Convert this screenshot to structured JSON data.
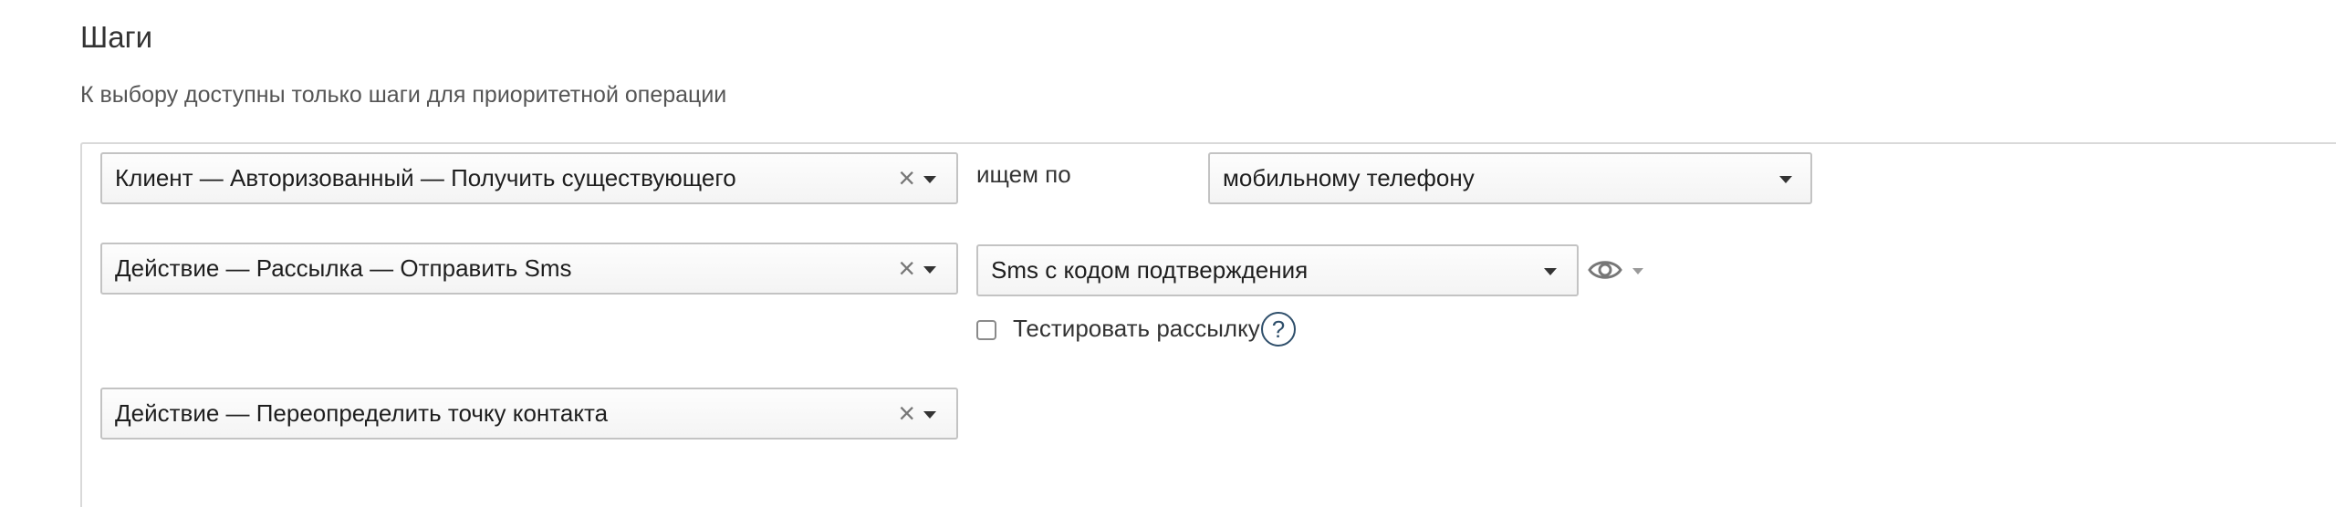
{
  "section": {
    "title": "Шаги",
    "subtitle": "К выбору доступны только шаги для приоритетной операции"
  },
  "steps": [
    {
      "select_value": "Клиент — Авторизованный — Получить существующего",
      "search_label": "ищем по",
      "search_by_value": "мобильному телефону"
    },
    {
      "select_value": "Действие — Рассылка — Отправить Sms",
      "mailing_value": "Sms с кодом подтверждения",
      "test_checkbox_label": "Тестировать рассылку",
      "test_checkbox_checked": false,
      "help_icon": "?"
    },
    {
      "select_value": "Действие — Переопределить точку контакта"
    }
  ],
  "icons": {
    "clear": "×",
    "caret": "chevron-down-icon",
    "preview": "eye-icon"
  }
}
